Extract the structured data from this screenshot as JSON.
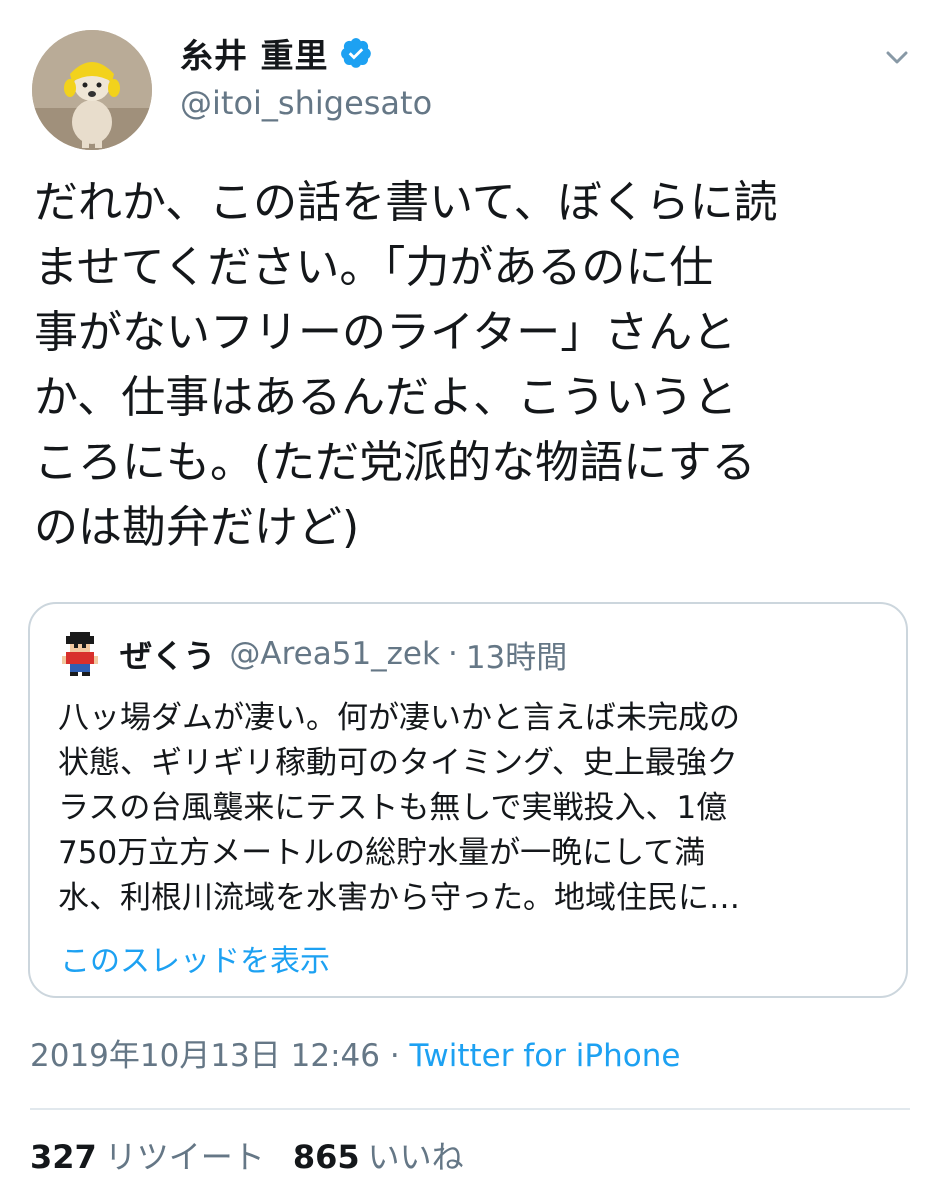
{
  "author": {
    "display_name": "糸井 重里",
    "handle": "@itoi_shigesato",
    "verified_icon": "verified-badge",
    "avatar_icon": "dog-photo"
  },
  "tweet": {
    "text": "だれか、この話を書いて、ぼくらに読\nませてください。「力があるのに仕\n事がないフリーのライター」さんと\nか、仕事はあるんだよ、こういうと\nころにも。(ただ党派的な物語にする\nのは勘弁だけど)"
  },
  "quoted_tweet": {
    "display_name": "ぜくう",
    "handle": "@Area51_zek",
    "separator": "·",
    "time": "13時間",
    "text": "八ッ場ダムが凄い。何が凄いかと言えば未完成の\n状態、ギリギリ稼動可のタイミング、史上最強ク\nラスの台風襲来にテストも無しで実戦投入、1億\n750万立方メートルの総貯水量が一晩にして満\n水、利根川流域を水害から守った。地域住民に…",
    "thread_link": "このスレッドを表示"
  },
  "meta": {
    "timestamp": "2019年10月13日 12:46",
    "separator": " · ",
    "source": "Twitter for iPhone"
  },
  "stats": {
    "retweets_count": "327",
    "retweets_label": "リツイート",
    "likes_count": "865",
    "likes_label": "いいね"
  },
  "colors": {
    "link": "#1da1f2",
    "secondary_text": "#657786",
    "primary_text": "#14171a",
    "border": "#ccd6dd"
  }
}
